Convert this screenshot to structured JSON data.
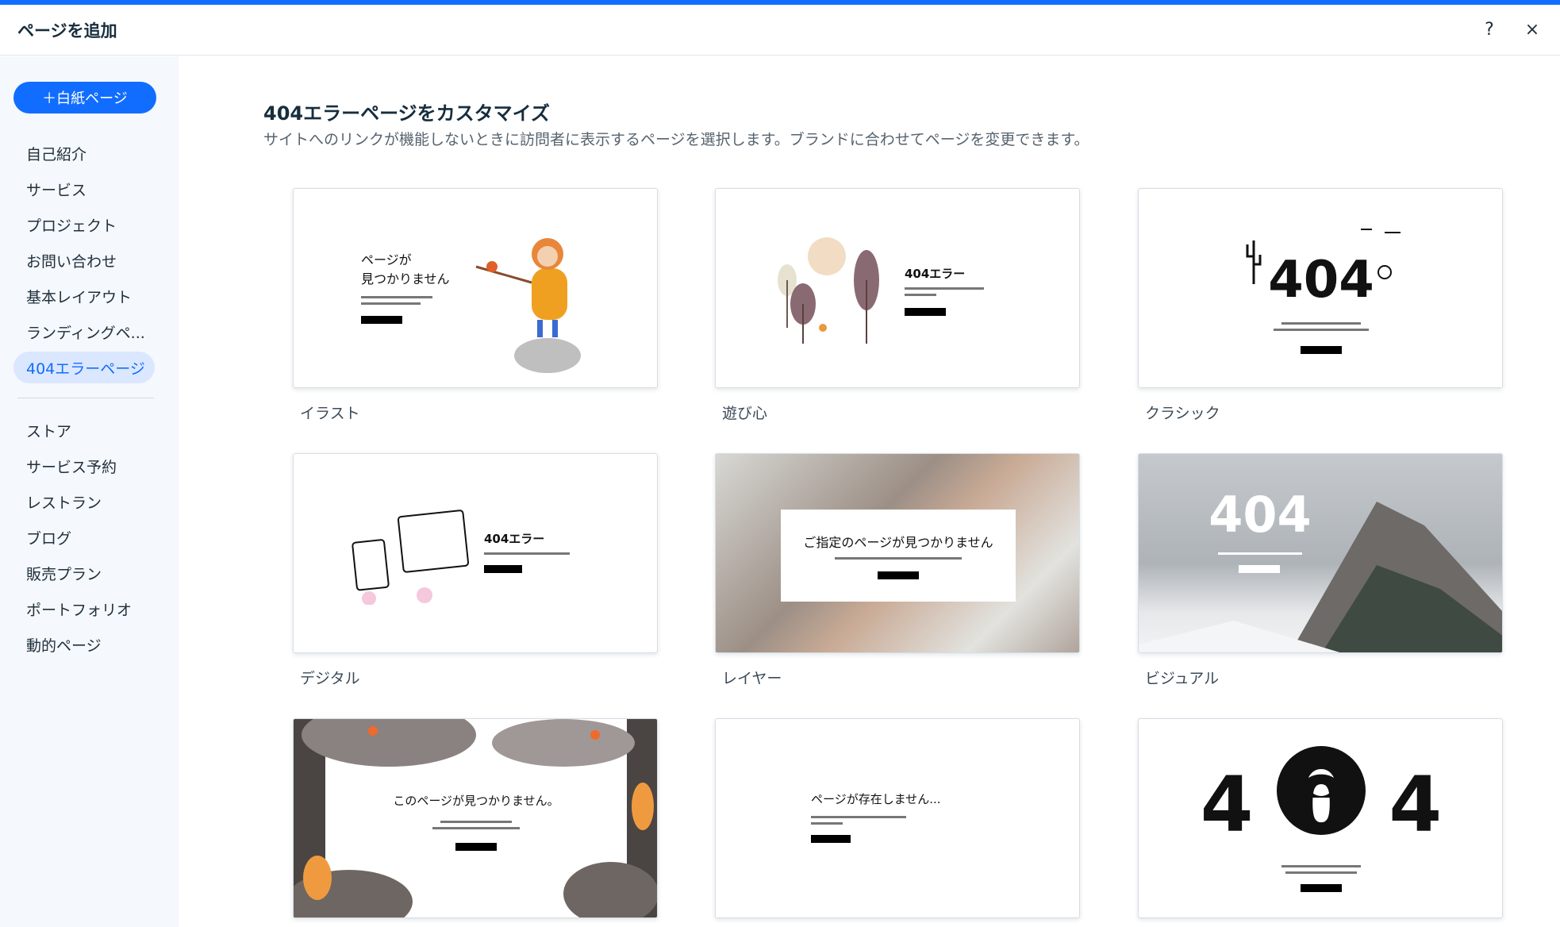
{
  "header": {
    "title": "ページを追加",
    "help_label": "?",
    "close_label": "×"
  },
  "sidebar": {
    "blank_page_button": "＋白紙ページ",
    "items_top": [
      "自己紹介",
      "サービス",
      "プロジェクト",
      "お問い合わせ",
      "基本レイアウト",
      "ランディングペ...",
      "404エラーページ"
    ],
    "items_bottom": [
      "ストア",
      "サービス予約",
      "レストラン",
      "ブログ",
      "販売プラン",
      "ポートフォリオ",
      "動的ページ"
    ],
    "active_item": "404エラーページ"
  },
  "main": {
    "title": "404エラーページをカスタマイズ",
    "subtitle": "サイトへのリンクが機能しないときに訪問者に表示するページを選択します。ブランドに合わせてページを変更できます。",
    "templates": [
      {
        "label": "イラスト",
        "heading": "ページが\n見つかりません"
      },
      {
        "label": "遊び心",
        "heading": "404エラー"
      },
      {
        "label": "クラシック",
        "heading": "404"
      },
      {
        "label": "デジタル",
        "heading": "404エラー"
      },
      {
        "label": "レイヤー",
        "heading": "ご指定のページが見つかりません"
      },
      {
        "label": "ビジュアル",
        "heading": "404"
      },
      {
        "label": "",
        "heading": "このページが見つかりません。"
      },
      {
        "label": "",
        "heading": "ページが存在しません..."
      },
      {
        "label": "",
        "heading": "404"
      }
    ]
  },
  "colors": {
    "accent": "#116dff",
    "active_bg": "#dbe7ff",
    "sidebar_bg": "#f5f8fc"
  }
}
